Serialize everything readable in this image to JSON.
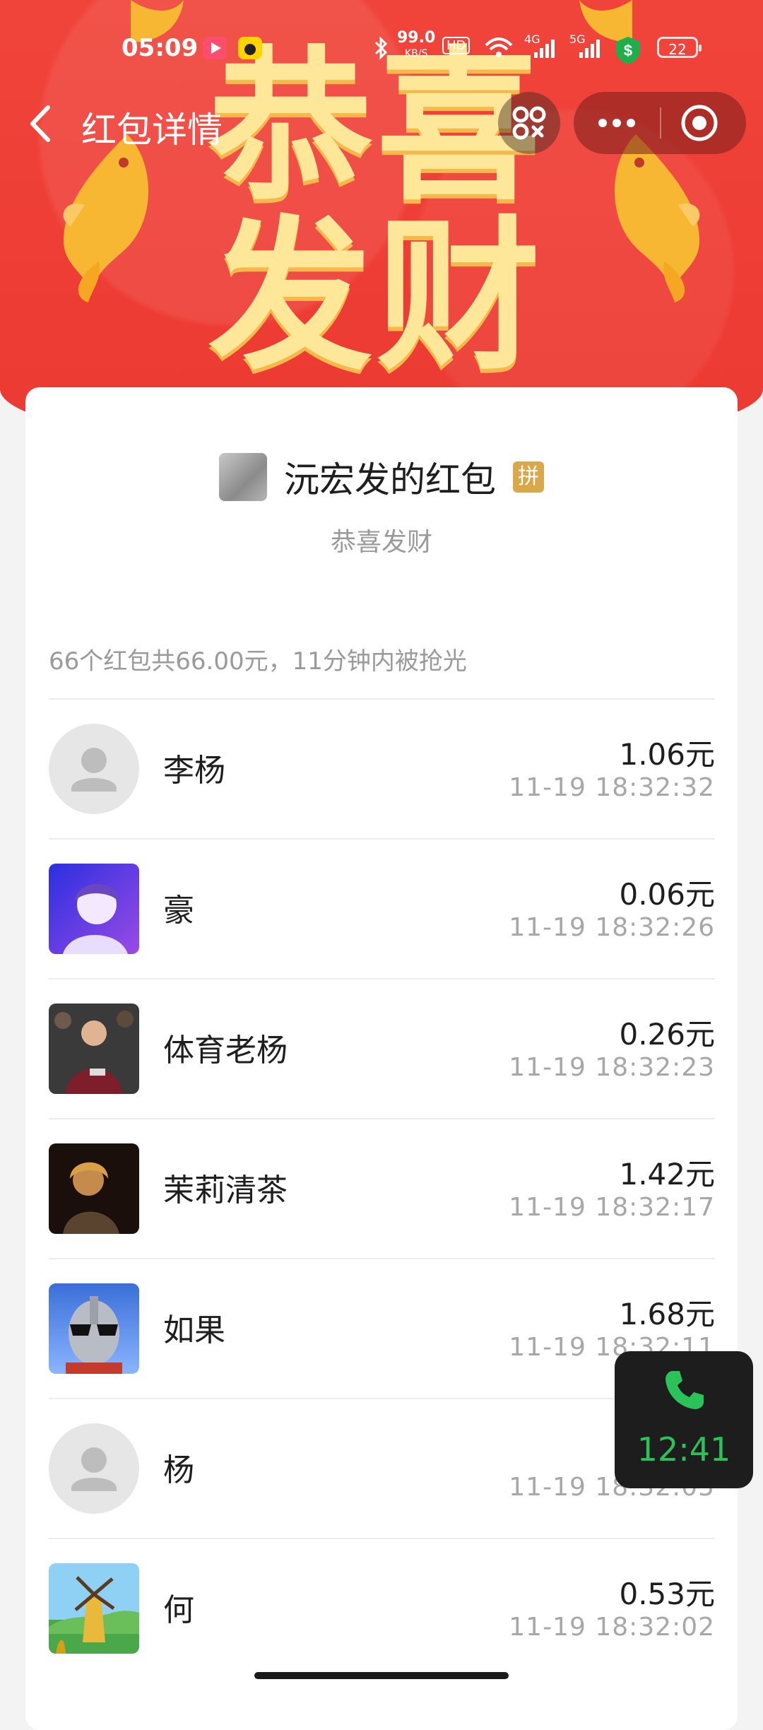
{
  "status_bar": {
    "time": "05:09",
    "network_speed": "99.0",
    "network_unit": "KB/S",
    "hd_label": "HD",
    "net_4g": "4G",
    "net_5g": "5G",
    "battery": "22"
  },
  "header": {
    "title": "红包详情"
  },
  "banner": {
    "chars": "恭喜发财"
  },
  "sender": {
    "name": "沅宏发的红包",
    "badge": "拼",
    "greeting": "恭喜发财"
  },
  "summary": "66个红包共66.00元，11分钟内被抢光",
  "records": [
    {
      "name": "李杨",
      "amount": "1.06元",
      "time": "11-19 18:32:32",
      "avatar": "default"
    },
    {
      "name": "豪",
      "amount": "0.06元",
      "time": "11-19 18:32:26",
      "avatar": "anime"
    },
    {
      "name": "体育老杨",
      "amount": "0.26元",
      "time": "11-19 18:32:23",
      "avatar": "football"
    },
    {
      "name": "茉莉清茶",
      "amount": "1.42元",
      "time": "11-19 18:32:17",
      "avatar": "portrait"
    },
    {
      "name": "如果",
      "amount": "1.68元",
      "time": "11-19 18:32:11",
      "avatar": "robot"
    },
    {
      "name": "杨",
      "amount": "",
      "time": "11-19 18:32:05",
      "avatar": "default"
    },
    {
      "name": "何",
      "amount": "0.53元",
      "time": "11-19 18:32:02",
      "avatar": "windmill"
    }
  ],
  "call_widget": {
    "duration": "12:41",
    "icon": "phone-icon",
    "color": "#2bc25a"
  },
  "colors": {
    "banner_red": "#ee3d35",
    "gold": "#ffe79a",
    "badge": "#d8a84a"
  }
}
